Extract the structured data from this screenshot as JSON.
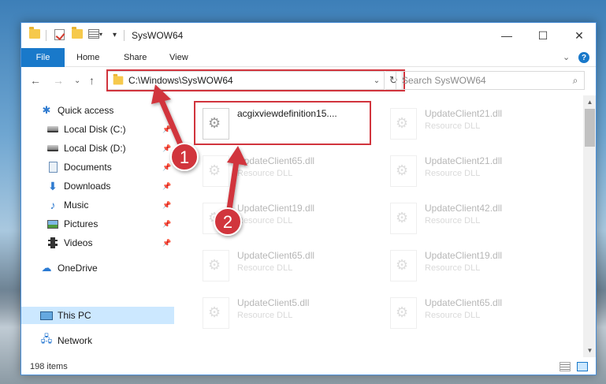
{
  "window": {
    "title": "SysWOW64",
    "minimize": "—",
    "maximize": "☐",
    "close": "✕"
  },
  "ribbon": {
    "tabs": [
      "File",
      "Home",
      "Share",
      "View"
    ],
    "expand": "⌄"
  },
  "nav": {
    "back": "←",
    "forward": "→",
    "recent": "⌄",
    "up": "↑",
    "address": "C:\\Windows\\SysWOW64",
    "dropdown": "⌄",
    "refresh": "↻",
    "search_placeholder": "Search SysWOW64",
    "search_icon": "⌕"
  },
  "sidebar": {
    "items": [
      {
        "label": "Quick access",
        "icon": "star-icon",
        "pinned": false
      },
      {
        "label": "Local Disk (C:)",
        "icon": "disk-icon",
        "pinned": true
      },
      {
        "label": "Local Disk (D:)",
        "icon": "disk-icon",
        "pinned": true
      },
      {
        "label": "Documents",
        "icon": "documents-icon",
        "pinned": true
      },
      {
        "label": "Downloads",
        "icon": "download-icon",
        "pinned": true
      },
      {
        "label": "Music",
        "icon": "music-icon",
        "pinned": true
      },
      {
        "label": "Pictures",
        "icon": "pictures-icon",
        "pinned": true
      },
      {
        "label": "Videos",
        "icon": "videos-icon",
        "pinned": true
      },
      {
        "label": "OneDrive",
        "icon": "cloud-icon",
        "pinned": false
      },
      {
        "label": "This PC",
        "icon": "computer-icon",
        "pinned": false,
        "selected": true
      },
      {
        "label": "Network",
        "icon": "network-icon",
        "pinned": false
      }
    ]
  },
  "files": [
    {
      "name": "acgixviewdefinition15....",
      "type": ""
    },
    {
      "name": "UpdateClient21.dll",
      "type": "Resource DLL"
    },
    {
      "name": "UpdateClient65.dll",
      "type": "Resource DLL"
    },
    {
      "name": "UpdateClient21.dll",
      "type": "Resource DLL"
    },
    {
      "name": "UpdateClient19.dll",
      "type": "Resource DLL"
    },
    {
      "name": "UpdateClient42.dll",
      "type": "Resource DLL"
    },
    {
      "name": "UpdateClient65.dll",
      "type": "Resource DLL"
    },
    {
      "name": "UpdateClient19.dll",
      "type": "Resource DLL"
    },
    {
      "name": "UpdateClient5.dll",
      "type": "Resource DLL"
    },
    {
      "name": "UpdateClient65.dll",
      "type": "Resource DLL"
    }
  ],
  "status": {
    "item_count": "198 items"
  },
  "annotations": {
    "step1": "1",
    "step2": "2",
    "color": "#d1343d"
  },
  "colors": {
    "accent": "#1979ca",
    "selected": "#cce8ff"
  }
}
